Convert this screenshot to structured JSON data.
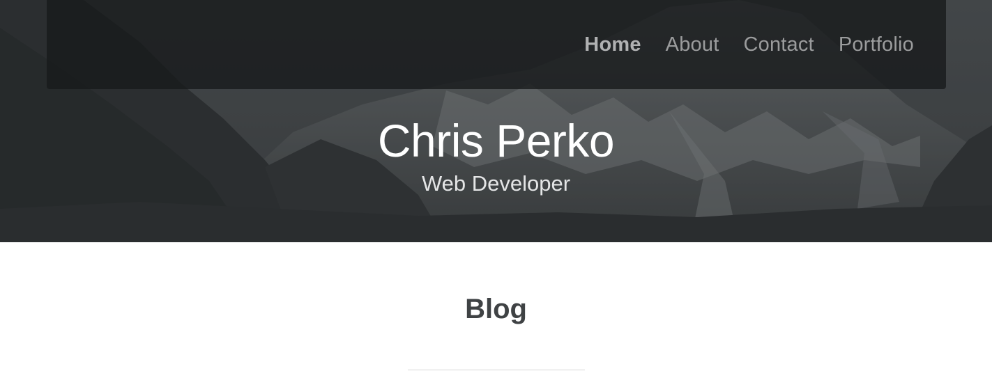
{
  "nav": {
    "links": [
      {
        "label": "Home",
        "active": true
      },
      {
        "label": "About",
        "active": false
      },
      {
        "label": "Contact",
        "active": false
      },
      {
        "label": "Portfolio",
        "active": false
      }
    ]
  },
  "hero": {
    "title": "Chris Perko",
    "subtitle": "Web Developer"
  },
  "main": {
    "section_title": "Blog"
  },
  "colors": {
    "navbar_bg": "#1a1c1d",
    "hero_overlay": "#3a3d40",
    "title_text": "#ffffff",
    "section_title": "#3f4244"
  }
}
